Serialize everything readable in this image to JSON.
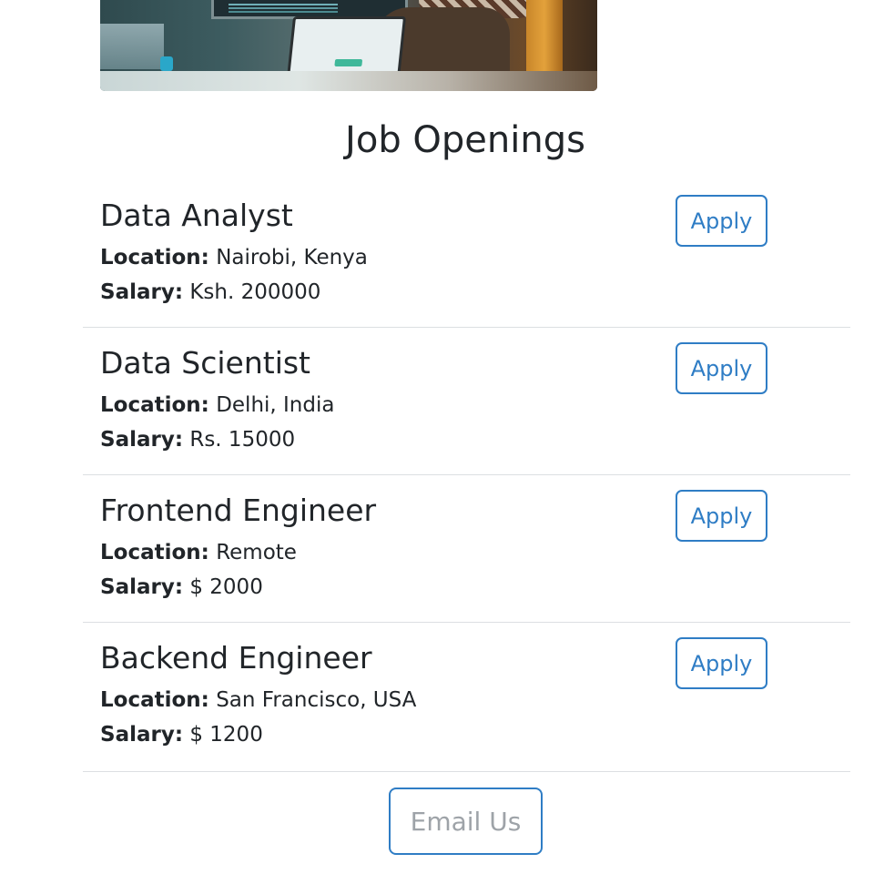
{
  "page": {
    "title": "Job Openings",
    "location_label": "Location:",
    "salary_label": "Salary:"
  },
  "hero": {
    "icon": "office-workspace-image"
  },
  "jobs": [
    {
      "title": "Data Analyst",
      "location": "Nairobi, Kenya",
      "salary": "Ksh. 200000",
      "apply_label": "Apply"
    },
    {
      "title": "Data Scientist",
      "location": "Delhi, India",
      "salary": "Rs. 15000",
      "apply_label": "Apply"
    },
    {
      "title": "Frontend Engineer",
      "location": "Remote",
      "salary": "$ 2000",
      "apply_label": "Apply"
    },
    {
      "title": "Backend Engineer",
      "location": "San Francisco, USA",
      "salary": "$ 1200",
      "apply_label": "Apply"
    }
  ],
  "footer": {
    "email_label": "Email Us"
  },
  "colors": {
    "accent": "#2f7dc5",
    "text": "#212529",
    "muted": "#9ea3a8",
    "divider": "#dcdfe2"
  }
}
